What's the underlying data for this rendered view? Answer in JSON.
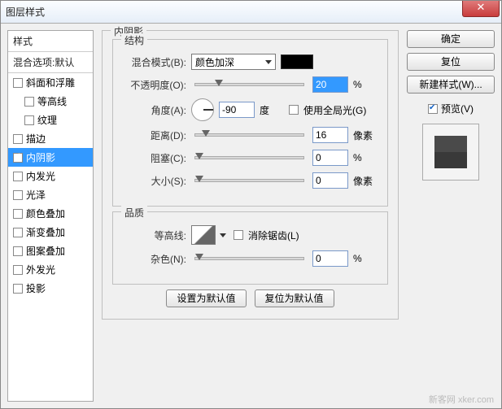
{
  "window": {
    "title": "图层样式"
  },
  "sidebar": {
    "style_header": "样式",
    "blend_header": "混合选项:默认",
    "items": [
      {
        "label": "斜面和浮雕",
        "checked": false,
        "indent": false,
        "selected": false
      },
      {
        "label": "等高线",
        "checked": false,
        "indent": true,
        "selected": false
      },
      {
        "label": "纹理",
        "checked": false,
        "indent": true,
        "selected": false
      },
      {
        "label": "描边",
        "checked": false,
        "indent": false,
        "selected": false
      },
      {
        "label": "内阴影",
        "checked": true,
        "indent": false,
        "selected": true
      },
      {
        "label": "内发光",
        "checked": false,
        "indent": false,
        "selected": false
      },
      {
        "label": "光泽",
        "checked": false,
        "indent": false,
        "selected": false
      },
      {
        "label": "颜色叠加",
        "checked": false,
        "indent": false,
        "selected": false
      },
      {
        "label": "渐变叠加",
        "checked": false,
        "indent": false,
        "selected": false
      },
      {
        "label": "图案叠加",
        "checked": false,
        "indent": false,
        "selected": false
      },
      {
        "label": "外发光",
        "checked": false,
        "indent": false,
        "selected": false
      },
      {
        "label": "投影",
        "checked": false,
        "indent": false,
        "selected": false
      }
    ]
  },
  "panel": {
    "title": "内阴影",
    "structure": {
      "legend": "结构",
      "blend_mode_label": "混合模式(B):",
      "blend_mode_value": "颜色加深",
      "opacity_label": "不透明度(O):",
      "opacity_value": "20",
      "opacity_unit": "%",
      "angle_label": "角度(A):",
      "angle_value": "-90",
      "angle_unit": "度",
      "global_light_label": "使用全局光(G)",
      "distance_label": "距离(D):",
      "distance_value": "16",
      "distance_unit": "像素",
      "choke_label": "阻塞(C):",
      "choke_value": "0",
      "choke_unit": "%",
      "size_label": "大小(S):",
      "size_value": "0",
      "size_unit": "像素"
    },
    "quality": {
      "legend": "品质",
      "contour_label": "等高线:",
      "antialias_label": "消除锯齿(L)",
      "noise_label": "杂色(N):",
      "noise_value": "0",
      "noise_unit": "%"
    },
    "buttons": {
      "default_set": "设置为默认值",
      "default_reset": "复位为默认值"
    }
  },
  "right": {
    "ok": "确定",
    "cancel": "复位",
    "new_style": "新建样式(W)...",
    "preview_label": "预览(V)"
  },
  "watermark": "新客网  xker.com"
}
